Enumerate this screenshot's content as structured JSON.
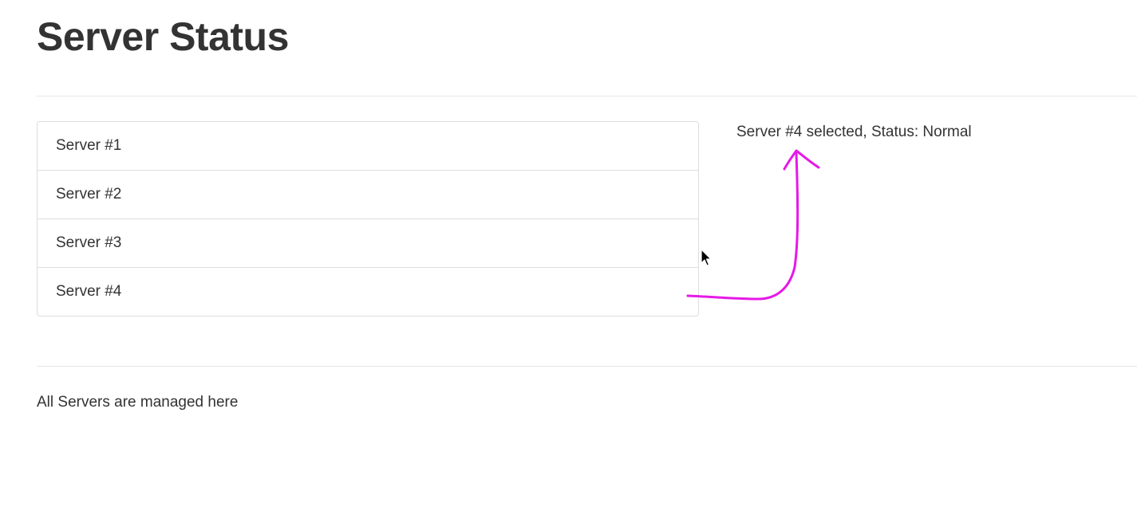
{
  "page": {
    "title": "Server Status"
  },
  "servers": [
    {
      "label": "Server #1"
    },
    {
      "label": "Server #2"
    },
    {
      "label": "Server #3"
    },
    {
      "label": "Server #4"
    }
  ],
  "selection": {
    "status_text": "Server #4 selected, Status: Normal"
  },
  "footer": {
    "text": "All Servers are managed here"
  },
  "annotation": {
    "color": "#e619e6",
    "icon": "hand-drawn-arrow"
  },
  "cursor": {
    "icon": "mouse-pointer-icon"
  }
}
